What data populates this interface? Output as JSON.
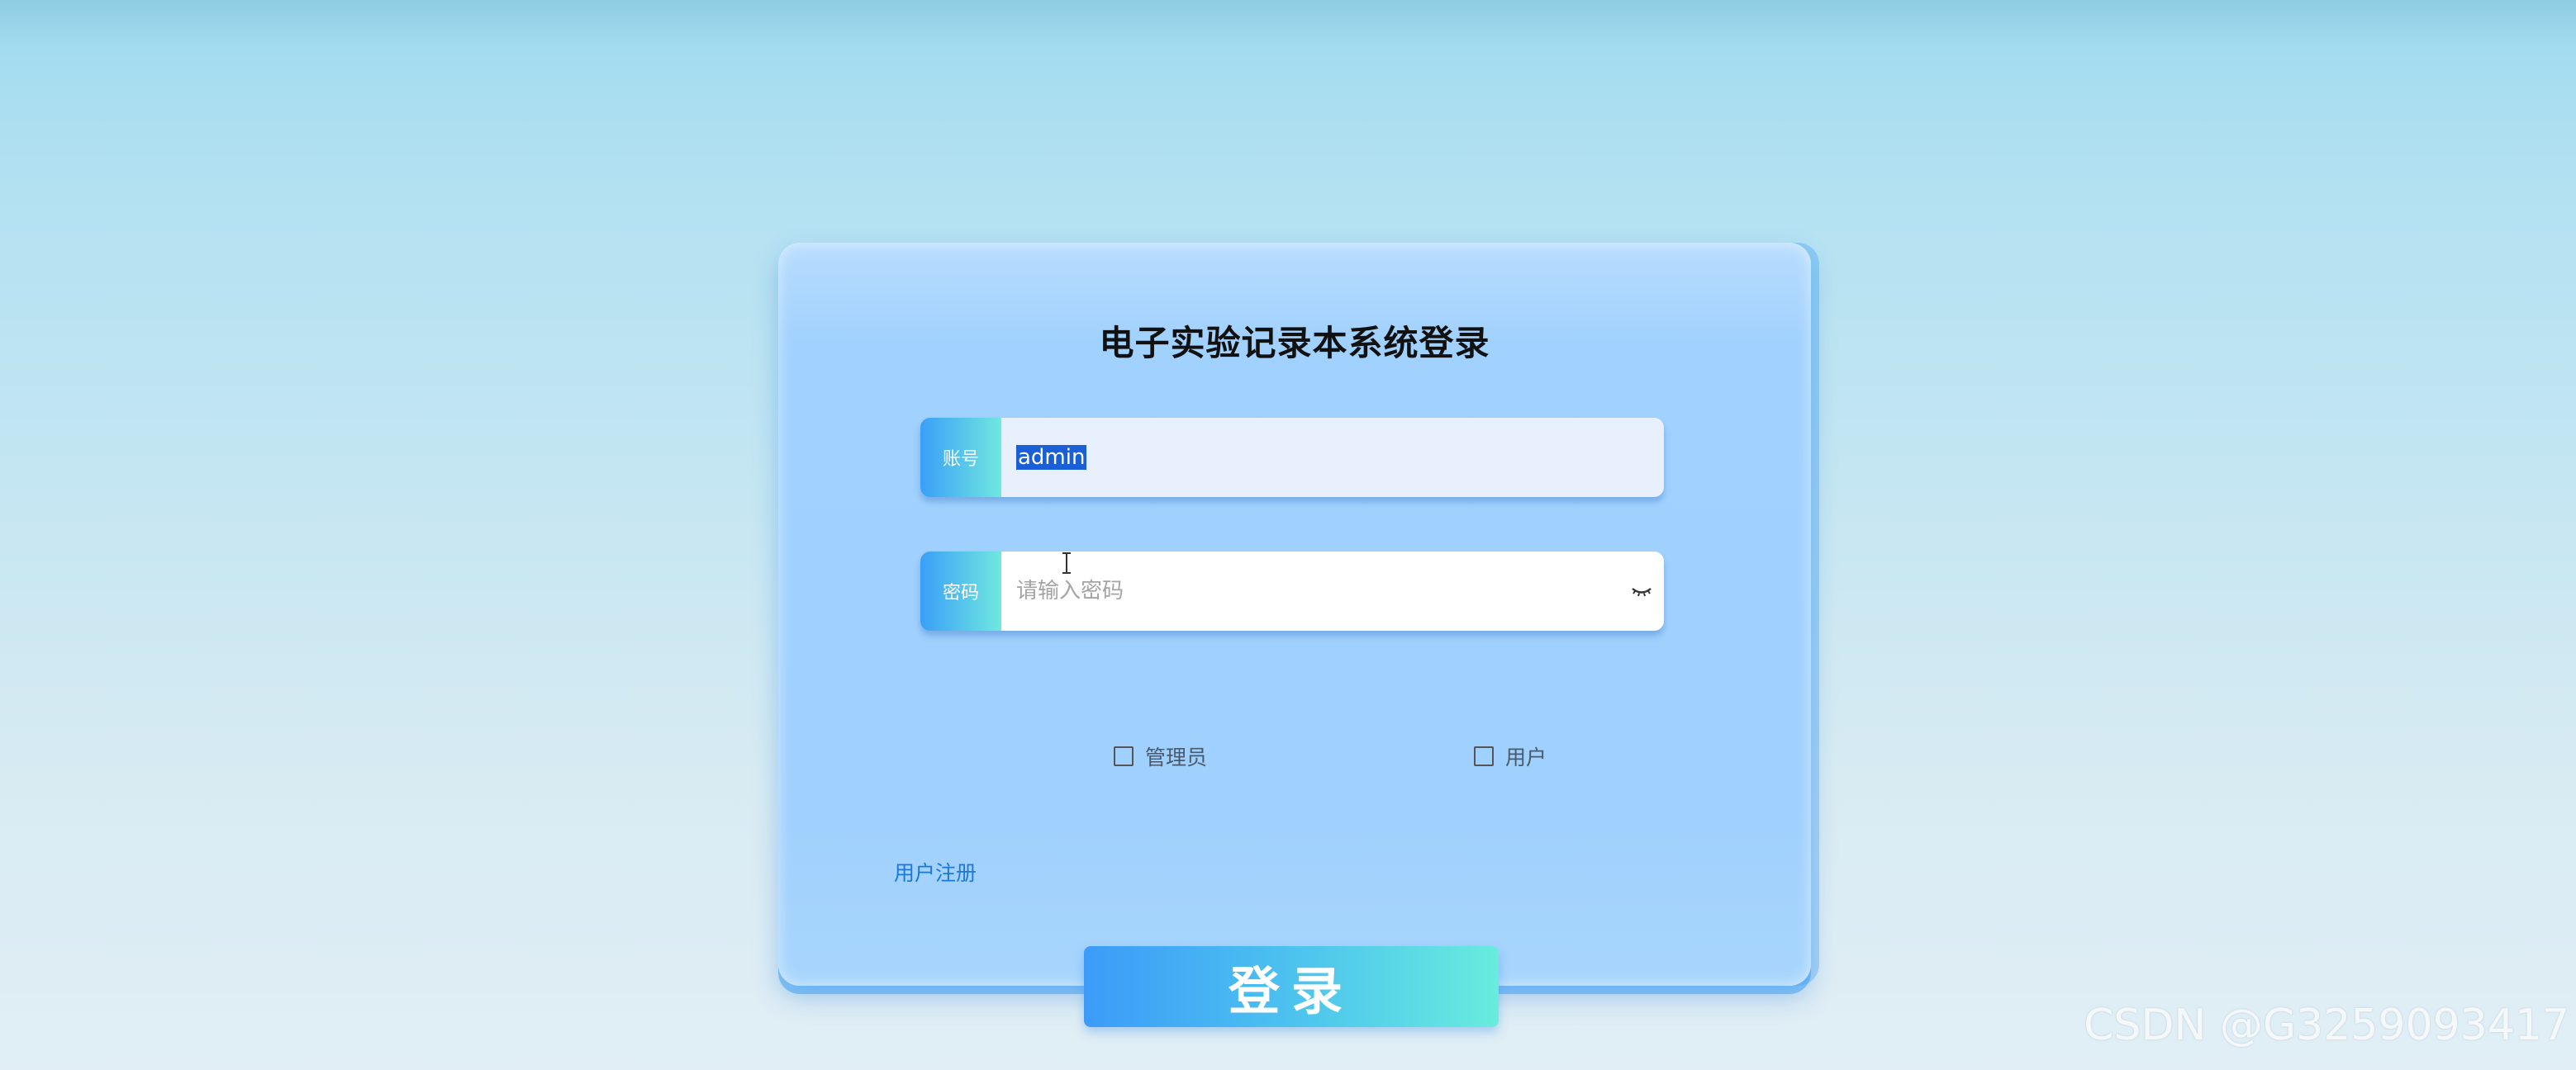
{
  "login": {
    "title": "电子实验记录本系统登录",
    "account_label": "账号",
    "account_value": "admin",
    "password_label": "密码",
    "password_placeholder": "请输入密码",
    "roles": [
      {
        "label": "管理员",
        "checked": false
      },
      {
        "label": "用户",
        "checked": false
      }
    ],
    "register_link": "用户注册",
    "submit_label": "登录"
  },
  "watermark": "CSDN @G3259093417",
  "icons": {
    "password_toggle": "eye-closed-icon",
    "cursor": "text-cursor-icon"
  },
  "colors": {
    "card_bg": "#a1d1fe",
    "accent_start": "#3a9ff8",
    "accent_end": "#6fe8df",
    "selection": "#1a5fd6",
    "link": "#1b79d6"
  }
}
